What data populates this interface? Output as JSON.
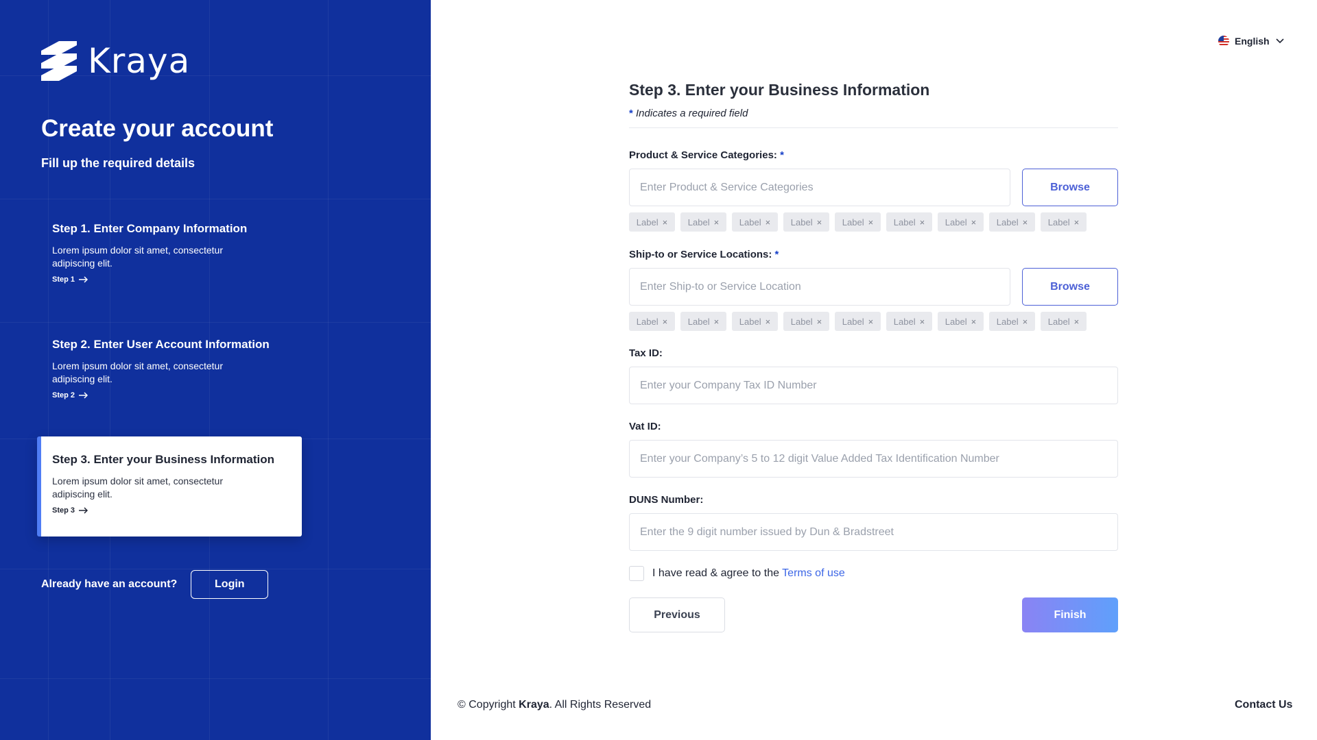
{
  "brand": {
    "name": "Kraya",
    "accent": "#10309d",
    "highlight": "#4f7df5"
  },
  "left": {
    "title": "Create your account",
    "subtitle": "Fill up the required details",
    "steps": [
      {
        "title": "Step 1. Enter Company Information",
        "desc": "Lorem ipsum dolor sit amet, consectetur adipiscing elit.",
        "link": "Step 1"
      },
      {
        "title": "Step 2. Enter User Account Information",
        "desc": "Lorem ipsum dolor sit amet, consectetur adipiscing elit.",
        "link": "Step 2"
      },
      {
        "title": "Step 3. Enter your Business Information",
        "desc": "Lorem ipsum dolor sit amet, consectetur adipiscing elit.",
        "link": "Step 3"
      }
    ],
    "account_prompt": "Already have an account?",
    "login_label": "Login"
  },
  "language": {
    "selected": "English"
  },
  "form": {
    "title": "Step 3. Enter your Business Information",
    "required_asterisk": "*",
    "required_note": "Indicates a required field",
    "categories": {
      "label": "Product & Service Categories:",
      "placeholder": "Enter Product & Service Categories",
      "browse_label": "Browse",
      "chips": [
        "Label",
        "Label",
        "Label",
        "Label",
        "Label",
        "Label",
        "Label",
        "Label",
        "Label"
      ]
    },
    "locations": {
      "label": "Ship-to or Service Locations:",
      "placeholder": "Enter Ship-to or Service Location",
      "browse_label": "Browse",
      "chips": [
        "Label",
        "Label",
        "Label",
        "Label",
        "Label",
        "Label",
        "Label",
        "Label",
        "Label"
      ]
    },
    "tax": {
      "label": "Tax ID:",
      "placeholder": "Enter your Company Tax ID Number"
    },
    "vat": {
      "label": "Vat ID:",
      "placeholder": "Enter your Company’s 5 to 12 digit Value Added Tax Identification Number"
    },
    "duns": {
      "label": "DUNS Number:",
      "placeholder": "Enter the 9 digit number issued by Dun & Bradstreet"
    },
    "agree_text": "I have read & agree to the",
    "terms_link": "Terms of use",
    "previous_label": "Previous",
    "finish_label": "Finish"
  },
  "footer": {
    "copyright_prefix": "© Copyright",
    "copyright_brand": "Kraya",
    "copyright_suffix": ". All Rights Reserved",
    "contact_label": "Contact Us"
  },
  "icons": {
    "arrow": "arrow-right-icon",
    "chip_close": "close-icon",
    "dropdown": "chevron-down-icon",
    "flag": "us-flag-icon"
  }
}
